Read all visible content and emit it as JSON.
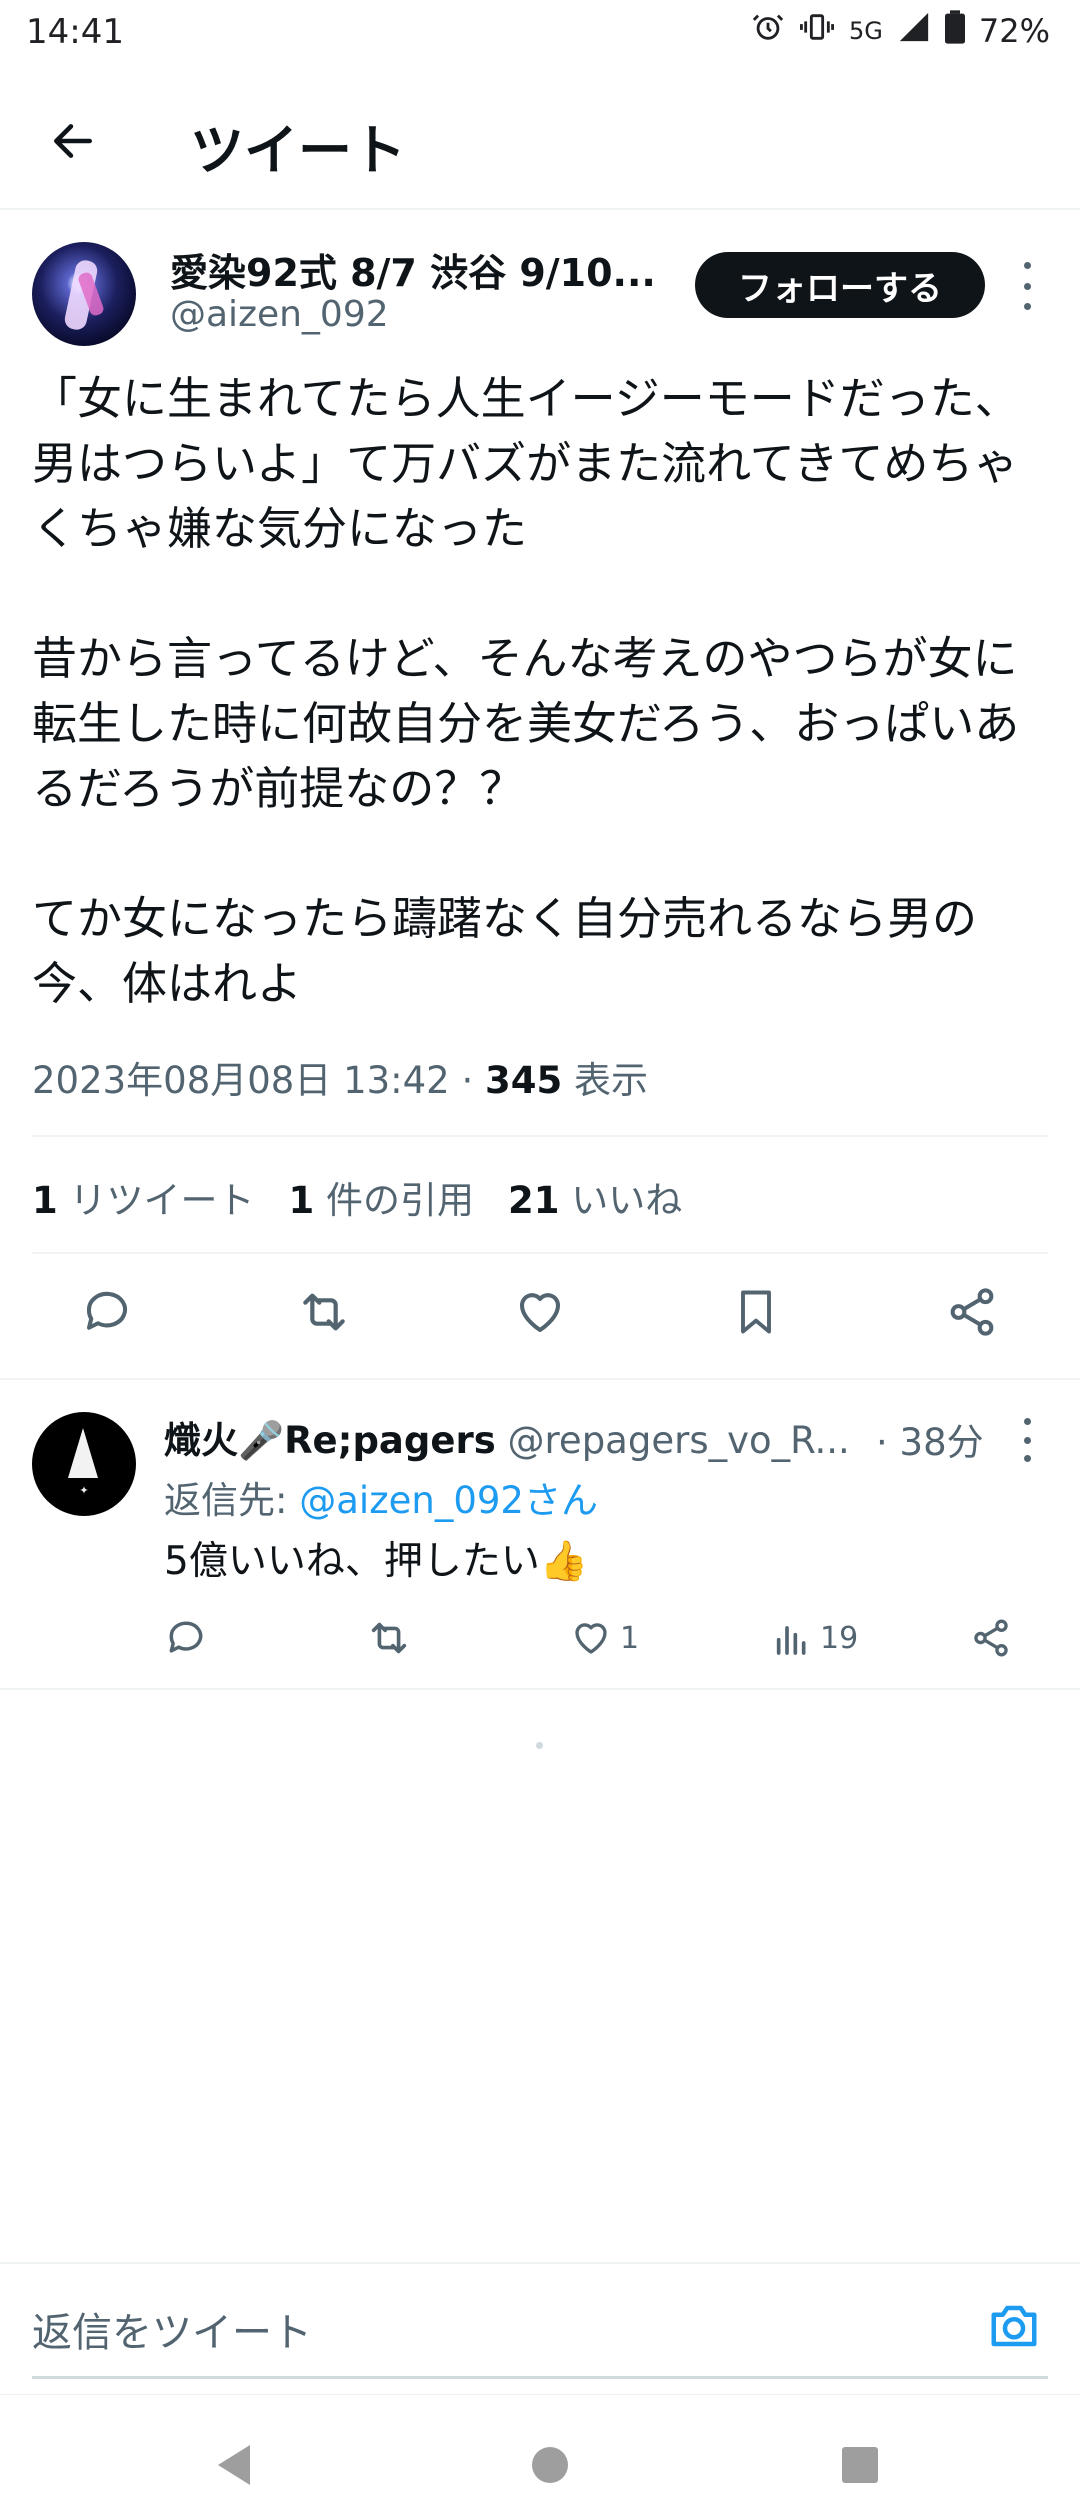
{
  "status_bar": {
    "time": "14:41",
    "network": "5G",
    "battery": "72%"
  },
  "header": {
    "title": "ツイート",
    "back_icon": "arrow-left-icon"
  },
  "tweet": {
    "author_name": "愛染92式 8/7 渋谷 9/10...",
    "author_handle": "@aizen_092",
    "follow_label": "フォローする",
    "paragraphs": [
      "「女に生まれてたら人生イージーモードだった、男はつらいよ」て万バズがまた流れてきてめちゃくちゃ嫌な気分になった",
      "昔から言ってるけど、そんな考えのやつらが女に転生した時に何故自分を美女だろう、おっぱいあるだろうが前提なの？？",
      "てか女になったら躊躇なく自分売れるなら男の今、体はれよ"
    ],
    "timestamp": "2023年08月08日 13:42 · ",
    "views_count": "345",
    "views_label": " 表示",
    "retweets_count": "1",
    "retweets_label": " リツイート",
    "quotes_count": "1",
    "quotes_label": " 件の引用",
    "likes_count": "21",
    "likes_label": " いいね"
  },
  "reply": {
    "author_name": "熾火🎤Re;pagers",
    "author_handle": "@repagers_vo_R...",
    "time": "· 38分",
    "reply_to_label": "返信先: ",
    "reply_to_handle": "@aizen_092さん",
    "text": "5億いいね、押したい👍",
    "like_count": "1",
    "views_count": "19"
  },
  "composer": {
    "placeholder": "返信をツイート"
  },
  "colors": {
    "accent": "#1d9bf0",
    "text_primary": "#0f1419",
    "text_secondary": "#536471",
    "divider": "#eff3f4",
    "follow_button": "#0f1419"
  }
}
